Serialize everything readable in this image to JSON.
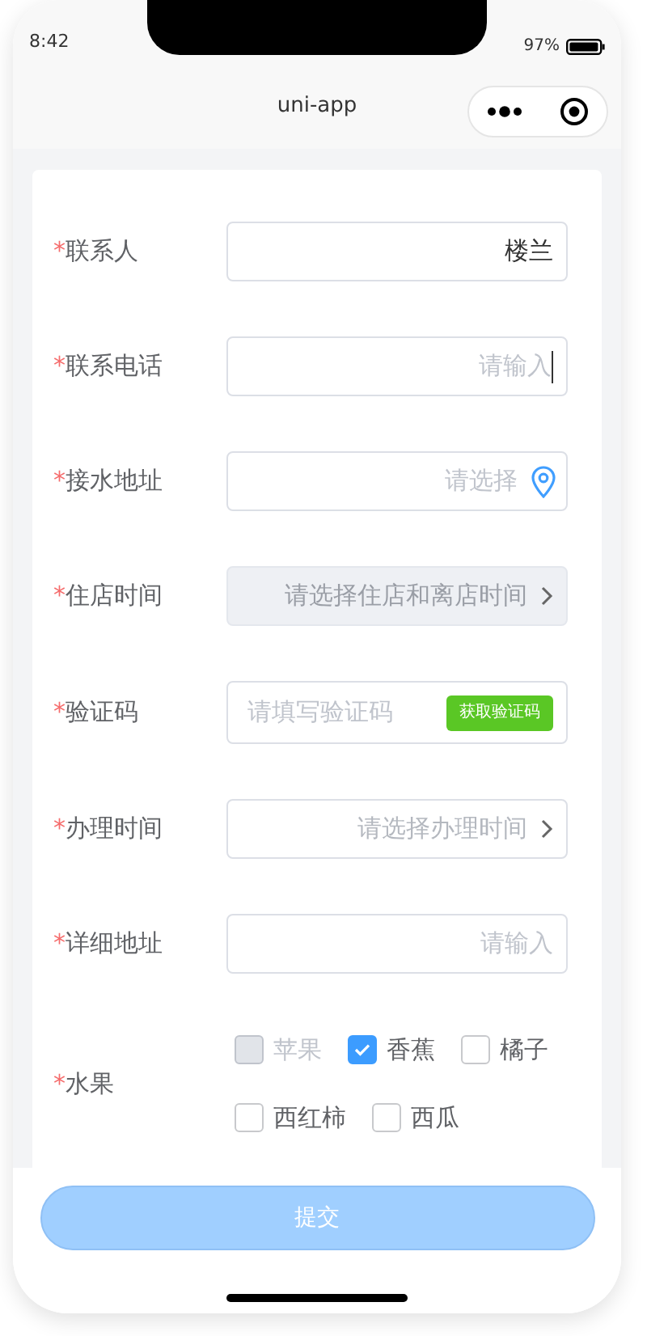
{
  "status_bar": {
    "time": "8:42",
    "battery": "97%"
  },
  "nav_bar": {
    "title": "uni-app"
  },
  "form": {
    "fields": [
      {
        "required_mark": "*",
        "label": "联系人",
        "kind": "input",
        "value": "楼兰"
      },
      {
        "required_mark": "*",
        "label": "联系电话",
        "kind": "input",
        "placeholder": "请输入",
        "focused": true
      },
      {
        "required_mark": "*",
        "label": "接水地址",
        "kind": "location",
        "placeholder": "请选择"
      },
      {
        "required_mark": "*",
        "label": "住店时间",
        "kind": "picker",
        "placeholder": "请选择住店和离店时间",
        "disabled": true
      },
      {
        "required_mark": "*",
        "label": "验证码",
        "kind": "code",
        "placeholder": "请填写验证码",
        "button": "获取验证码"
      },
      {
        "required_mark": "*",
        "label": "办理时间",
        "kind": "picker",
        "placeholder": "请选择办理时间"
      },
      {
        "required_mark": "*",
        "label": "详细地址",
        "kind": "input",
        "placeholder": "请输入"
      }
    ],
    "fruits": {
      "required_mark": "*",
      "label": "水果",
      "options": [
        {
          "label": "苹果",
          "checked": false,
          "disabled": true
        },
        {
          "label": "香蕉",
          "checked": true,
          "disabled": false
        },
        {
          "label": "橘子",
          "checked": false,
          "disabled": false
        },
        {
          "label": "西红柿",
          "checked": false,
          "disabled": false
        },
        {
          "label": "西瓜",
          "checked": false,
          "disabled": false
        }
      ]
    }
  },
  "submit": {
    "label": "提交",
    "disabled": true
  }
}
